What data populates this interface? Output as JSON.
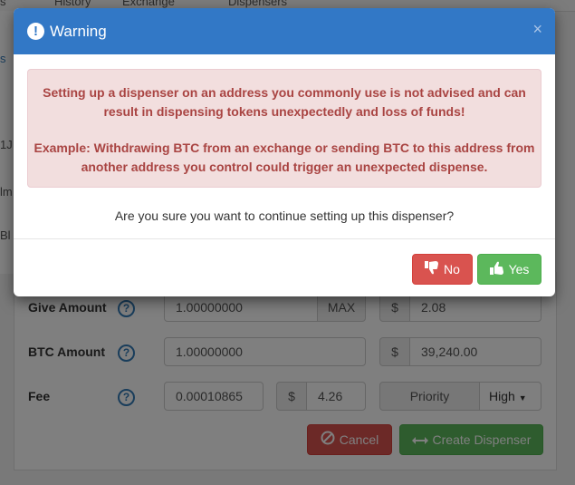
{
  "background": {
    "nav": {
      "history": "History",
      "exchange": "Exchange",
      "dispensers": "Dispensers"
    },
    "left_fragments": [
      "s",
      "1J",
      "lm",
      "Bl"
    ],
    "form": {
      "give_amount": {
        "label": "Give Amount",
        "value": "1.00000000",
        "max_label": "MAX",
        "currency_symbol": "$",
        "usd_value": "2.08"
      },
      "btc_amount": {
        "label": "BTC Amount",
        "value": "1.00000000",
        "currency_symbol": "$",
        "usd_value": "39,240.00"
      },
      "fee": {
        "label": "Fee",
        "value": "0.00010865",
        "currency_symbol": "$",
        "usd_value": "4.26",
        "priority_label": "Priority",
        "priority_value": "High"
      },
      "help_glyph": "?",
      "cancel_label": "Cancel",
      "create_label": "Create Dispenser"
    }
  },
  "modal": {
    "title": "Warning",
    "close_glyph": "×",
    "alert_line1": "Setting up a dispenser on an address you commonly use is not advised and can result in dispensing tokens unexpectedly and loss of funds!",
    "alert_line2": "Example: Withdrawing BTC from an exchange or sending BTC to this address from another address you control could trigger an unexpected dispense.",
    "question": "Are you sure you want to continue setting up this dispenser?",
    "no_label": "No",
    "yes_label": "Yes"
  },
  "colors": {
    "header": "#3278c6",
    "danger": "#d9534f",
    "success": "#5cb85c",
    "alert_bg": "#f2dede",
    "alert_text": "#a94442"
  }
}
